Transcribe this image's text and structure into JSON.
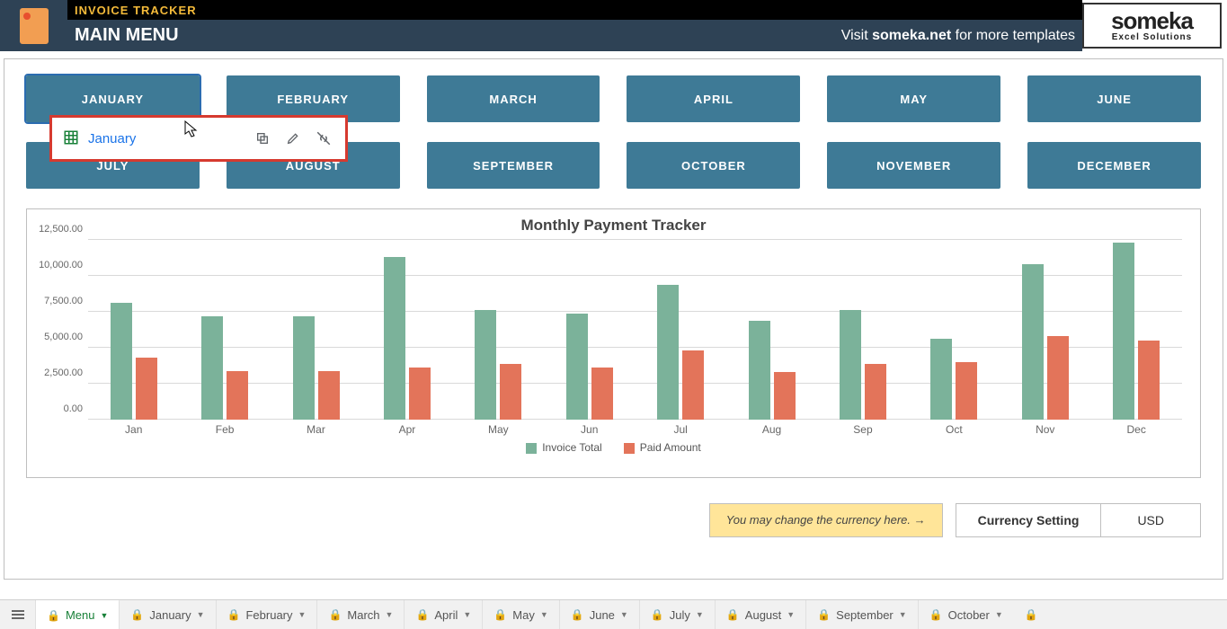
{
  "header": {
    "app_title": "INVOICE TRACKER",
    "page_title": "MAIN MENU",
    "visit_pre": "Visit ",
    "visit_bold": "someka.net",
    "visit_post": " for more templates",
    "brand_name": "someka",
    "brand_sub": "Excel Solutions"
  },
  "months_row1": [
    "JANUARY",
    "FEBRUARY",
    "MARCH",
    "APRIL",
    "MAY",
    "JUNE"
  ],
  "months_row2": [
    "JULY",
    "AUGUST",
    "SEPTEMBER",
    "OCTOBER",
    "NOVEMBER",
    "DECEMBER"
  ],
  "popup": {
    "link_text": "January"
  },
  "currency": {
    "hint": "You may change the currency here. →",
    "label": "Currency Setting",
    "value": "USD"
  },
  "sheet_tabs": [
    "Menu",
    "January",
    "February",
    "March",
    "April",
    "May",
    "June",
    "July",
    "August",
    "September",
    "October"
  ],
  "chart_data": {
    "type": "bar",
    "title": "Monthly Payment Tracker",
    "categories": [
      "Jan",
      "Feb",
      "Mar",
      "Apr",
      "May",
      "Jun",
      "Jul",
      "Aug",
      "Sep",
      "Oct",
      "Nov",
      "Dec"
    ],
    "series": [
      {
        "name": "Invoice Total",
        "values": [
          8100,
          7200,
          7200,
          11300,
          7600,
          7400,
          9400,
          6900,
          7600,
          5600,
          10800,
          12300
        ]
      },
      {
        "name": "Paid Amount",
        "values": [
          4300,
          3400,
          3400,
          3600,
          3900,
          3600,
          4800,
          3300,
          3900,
          4000,
          5800,
          5500
        ]
      }
    ],
    "ylabel": "",
    "xlabel": "",
    "ylim": [
      0,
      12500
    ],
    "y_ticks": [
      "0.00",
      "2,500.00",
      "5,000.00",
      "7,500.00",
      "10,000.00",
      "12,500.00"
    ]
  }
}
